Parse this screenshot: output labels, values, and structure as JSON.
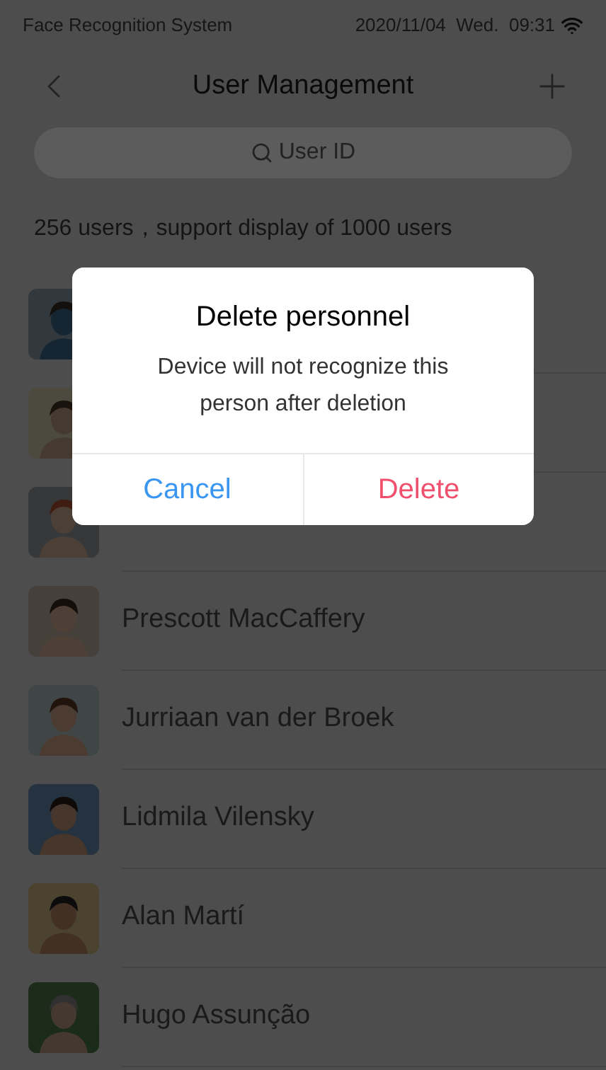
{
  "status_bar": {
    "app_name": "Face Recognition System",
    "datetime": "2020/11/04  Wed.  09:31"
  },
  "header": {
    "title": "User Management"
  },
  "search": {
    "placeholder": "User ID"
  },
  "summary": "256 users，support display of 1000 users",
  "users": [
    {
      "kind": "covered"
    },
    {
      "kind": "covered"
    },
    {
      "kind": "name-covered"
    },
    {
      "kind": "named",
      "name": "Prescott MacCaffery"
    },
    {
      "kind": "named",
      "name": "Jurriaan van der Broek"
    },
    {
      "kind": "named",
      "name": "Lidmila Vilensky"
    },
    {
      "kind": "named",
      "name": "Alan Martí"
    },
    {
      "kind": "named",
      "name": "Hugo Assunção"
    }
  ],
  "dialog": {
    "title": "Delete personnel",
    "message": "Device will not recognize this person after deletion",
    "buttons": [
      {
        "label": "Cancel",
        "kind": "cancel"
      },
      {
        "label": "Delete",
        "kind": "destructive"
      }
    ]
  }
}
